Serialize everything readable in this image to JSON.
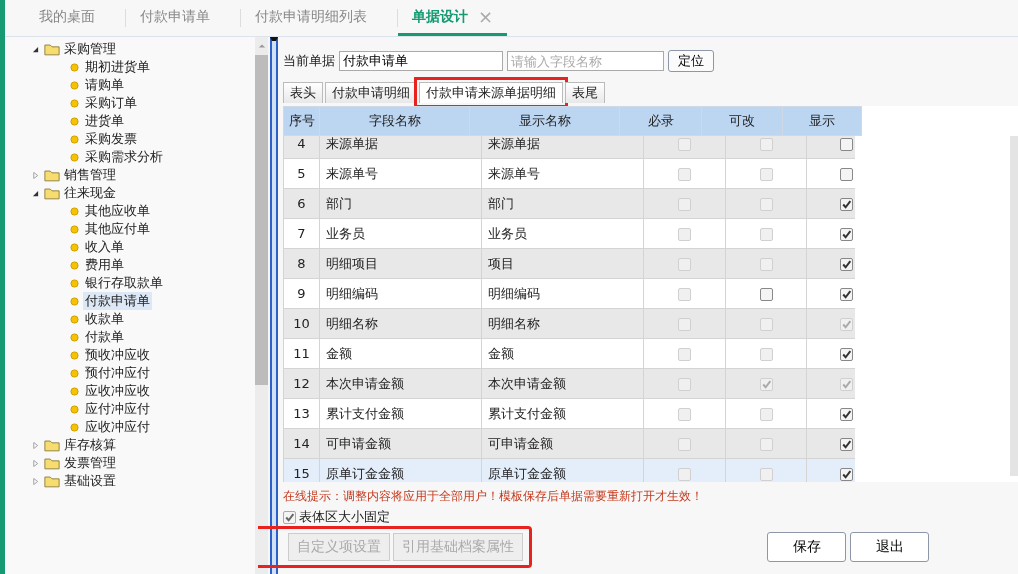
{
  "top_tabs": [
    {
      "label": "我的桌面",
      "selected": false,
      "closable": false
    },
    {
      "label": "付款申请单",
      "selected": false,
      "closable": false
    },
    {
      "label": "付款申请明细列表",
      "selected": false,
      "closable": false
    },
    {
      "label": "单据设计",
      "selected": true,
      "closable": true
    }
  ],
  "close_glyph": "×",
  "tree": [
    {
      "label": "采购管理",
      "expanded": true,
      "children": [
        {
          "label": "期初进货单",
          "selected": false
        },
        {
          "label": "请购单",
          "selected": false
        },
        {
          "label": "采购订单",
          "selected": false
        },
        {
          "label": "进货单",
          "selected": false
        },
        {
          "label": "采购发票",
          "selected": false
        },
        {
          "label": "采购需求分析",
          "selected": false
        }
      ]
    },
    {
      "label": "销售管理",
      "expanded": false
    },
    {
      "label": "往来现金",
      "expanded": true,
      "children": [
        {
          "label": "其他应收单",
          "selected": false
        },
        {
          "label": "其他应付单",
          "selected": false
        },
        {
          "label": "收入单",
          "selected": false
        },
        {
          "label": "费用单",
          "selected": false
        },
        {
          "label": "银行存取款单",
          "selected": false
        },
        {
          "label": "付款申请单",
          "selected": true
        },
        {
          "label": "收款单",
          "selected": false
        },
        {
          "label": "付款单",
          "selected": false
        },
        {
          "label": "预收冲应收",
          "selected": false
        },
        {
          "label": "预付冲应付",
          "selected": false
        },
        {
          "label": "应收冲应收",
          "selected": false
        },
        {
          "label": "应付冲应付",
          "selected": false
        },
        {
          "label": "应收冲应付",
          "selected": false
        }
      ]
    },
    {
      "label": "库存核算",
      "expanded": false
    },
    {
      "label": "发票管理",
      "expanded": false
    },
    {
      "label": "基础设置",
      "expanded": false
    }
  ],
  "toolbar": {
    "label": "当前单据",
    "document_value": "付款申请单",
    "search_placeholder": "请输入字段名称",
    "locate_button": "定位"
  },
  "sub_tabs": [
    {
      "label": "表头",
      "selected": false,
      "highlighted": false
    },
    {
      "label": "付款申请明细",
      "selected": false,
      "highlighted": false
    },
    {
      "label": "付款申请来源单据明细",
      "selected": true,
      "highlighted": true
    },
    {
      "label": "表尾",
      "selected": false,
      "highlighted": false
    }
  ],
  "table": {
    "columns": [
      "序号",
      "字段名称",
      "显示名称",
      "必录",
      "可改",
      "显示"
    ],
    "rows": [
      {
        "no": "4",
        "field": "来源单据",
        "display": "来源单据",
        "selected": false,
        "required": {
          "checked": false,
          "disabled": true
        },
        "editable": {
          "checked": false,
          "disabled": true
        },
        "visible": {
          "checked": false,
          "disabled": false
        }
      },
      {
        "no": "5",
        "field": "来源单号",
        "display": "来源单号",
        "selected": false,
        "required": {
          "checked": false,
          "disabled": true
        },
        "editable": {
          "checked": false,
          "disabled": true
        },
        "visible": {
          "checked": false,
          "disabled": false
        }
      },
      {
        "no": "6",
        "field": "部门",
        "display": "部门",
        "selected": false,
        "required": {
          "checked": false,
          "disabled": true
        },
        "editable": {
          "checked": false,
          "disabled": true
        },
        "visible": {
          "checked": true,
          "disabled": false
        }
      },
      {
        "no": "7",
        "field": "业务员",
        "display": "业务员",
        "selected": false,
        "required": {
          "checked": false,
          "disabled": true
        },
        "editable": {
          "checked": false,
          "disabled": true
        },
        "visible": {
          "checked": true,
          "disabled": false
        }
      },
      {
        "no": "8",
        "field": "明细项目",
        "display": "项目",
        "selected": false,
        "required": {
          "checked": false,
          "disabled": true
        },
        "editable": {
          "checked": false,
          "disabled": true
        },
        "visible": {
          "checked": true,
          "disabled": false
        }
      },
      {
        "no": "9",
        "field": "明细编码",
        "display": "明细编码",
        "selected": false,
        "required": {
          "checked": false,
          "disabled": true
        },
        "editable": {
          "checked": false,
          "disabled": false
        },
        "visible": {
          "checked": true,
          "disabled": false
        }
      },
      {
        "no": "10",
        "field": "明细名称",
        "display": "明细名称",
        "selected": false,
        "required": {
          "checked": false,
          "disabled": true
        },
        "editable": {
          "checked": false,
          "disabled": true
        },
        "visible": {
          "checked": true,
          "disabled": true
        }
      },
      {
        "no": "11",
        "field": "金额",
        "display": "金额",
        "selected": false,
        "required": {
          "checked": false,
          "disabled": true
        },
        "editable": {
          "checked": false,
          "disabled": true
        },
        "visible": {
          "checked": true,
          "disabled": false
        }
      },
      {
        "no": "12",
        "field": "本次申请金额",
        "display": "本次申请金额",
        "selected": false,
        "required": {
          "checked": false,
          "disabled": true
        },
        "editable": {
          "checked": true,
          "disabled": true
        },
        "visible": {
          "checked": true,
          "disabled": true
        }
      },
      {
        "no": "13",
        "field": "累计支付金额",
        "display": "累计支付金额",
        "selected": false,
        "required": {
          "checked": false,
          "disabled": true
        },
        "editable": {
          "checked": false,
          "disabled": true
        },
        "visible": {
          "checked": true,
          "disabled": false
        }
      },
      {
        "no": "14",
        "field": "可申请金额",
        "display": "可申请金额",
        "selected": false,
        "required": {
          "checked": false,
          "disabled": true
        },
        "editable": {
          "checked": false,
          "disabled": true
        },
        "visible": {
          "checked": true,
          "disabled": false
        }
      },
      {
        "no": "15",
        "field": "原单订金金额",
        "display": "原单订金金额",
        "selected": true,
        "required": {
          "checked": false,
          "disabled": true
        },
        "editable": {
          "checked": false,
          "disabled": true
        },
        "visible": {
          "checked": true,
          "disabled": false
        }
      }
    ]
  },
  "hint": "在线提示：调整内容将应用于全部用户！模板保存后单据需要重新打开才生效！",
  "fixed_size": {
    "label": "表体区大小固定",
    "checked": true
  },
  "extra_buttons": {
    "highlighted": true,
    "items": [
      {
        "label": "自定义项设置",
        "disabled": true
      },
      {
        "label": "引用基础档案属性",
        "disabled": true
      }
    ]
  },
  "action_buttons": [
    {
      "label": "保存"
    },
    {
      "label": "退出"
    }
  ]
}
